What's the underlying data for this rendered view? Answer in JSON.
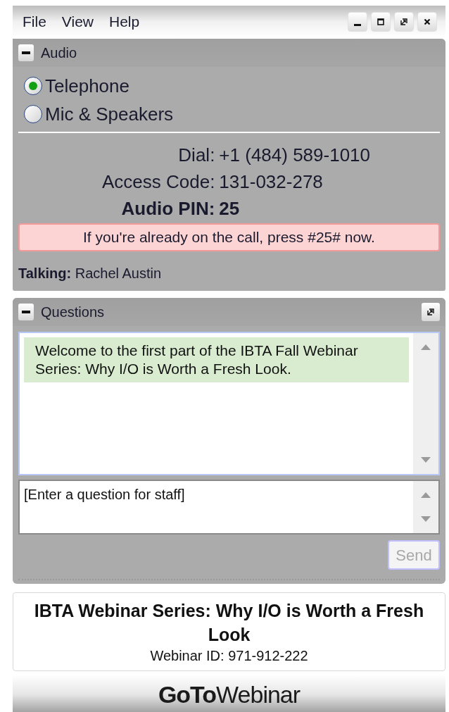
{
  "menu": [
    "File",
    "View",
    "Help"
  ],
  "window_buttons": [
    {
      "kind": "minimize"
    },
    {
      "kind": "maximize"
    },
    {
      "kind": "restore"
    },
    {
      "kind": "close"
    }
  ],
  "audio": {
    "title": "Audio",
    "options": [
      {
        "label": "Telephone",
        "selected": true
      },
      {
        "label": "Mic & Speakers",
        "selected": false
      }
    ],
    "details": [
      {
        "label": "Dial:",
        "value": "+1 (484) 589-1010",
        "bold": false
      },
      {
        "label": "Access Code:",
        "value": "131-032-278",
        "bold": false
      },
      {
        "label": "Audio PIN:",
        "value": "25",
        "bold": true
      }
    ],
    "notice": "If you're already on the call, press #25# now.",
    "talking": "**Talking:** Rachel Austin"
  },
  "questions": {
    "title": "Questions",
    "messages": [
      "Welcome to the first part of the IBTA Fall Webinar Series: Why I/O is Worth a Fresh Look."
    ],
    "input_placeholder": "[Enter a question for staff]",
    "send_button": {
      "label": "Send",
      "disabled": true
    }
  },
  "webinar": {
    "title": "IBTA Webinar Series: Why I/O is Worth a Fresh Look",
    "id": "Webinar ID: 971-912-222"
  },
  "logo": "**GoTo**Webinar"
}
